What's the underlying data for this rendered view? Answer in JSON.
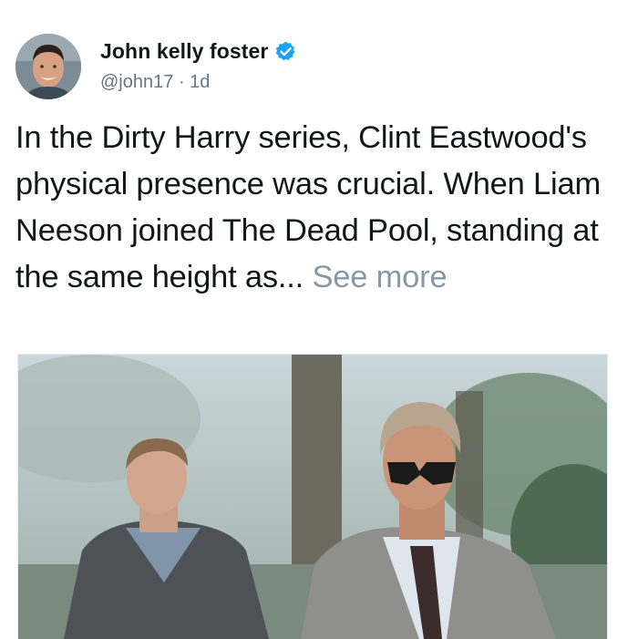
{
  "author": {
    "name": "John kelly foster",
    "handle": "@john17",
    "separator": "·",
    "time": "1d",
    "verified": true,
    "avatar_icon": "profile-photo"
  },
  "tweet": {
    "text": "In the Dirty Harry series, Clint Eastwood's physical presence was crucial. When Liam Neeson joined The Dead Pool, standing at the same height as...",
    "see_more_label": "See more"
  },
  "media": {
    "description_icon": "photo"
  },
  "colors": {
    "verified": "#1da1f2",
    "text": "#14171a",
    "secondary": "#657786",
    "see_more": "#8899a6"
  }
}
